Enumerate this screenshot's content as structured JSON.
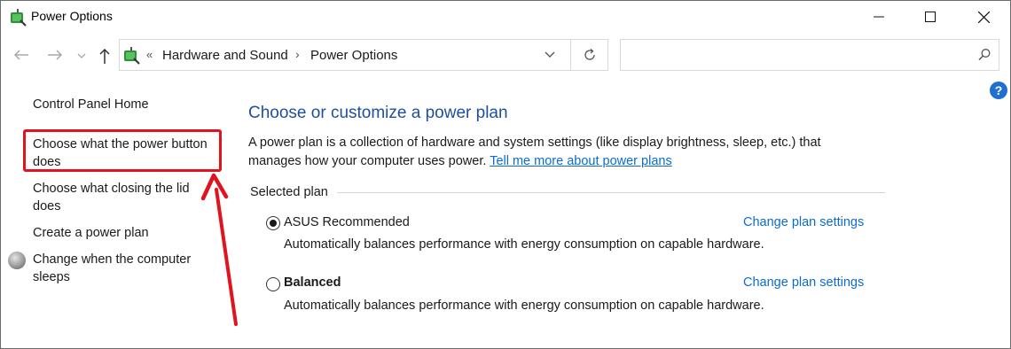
{
  "window": {
    "title": "Power Options"
  },
  "address": {
    "crumbs": [
      "Hardware and Sound",
      "Power Options"
    ],
    "search_placeholder": ""
  },
  "sidebar": {
    "items": [
      {
        "label": "Control Panel Home"
      },
      {
        "label": "Choose what the power button does"
      },
      {
        "label": "Choose what closing the lid does"
      },
      {
        "label": "Create a power plan"
      },
      {
        "label": "Change when the computer sleeps"
      }
    ]
  },
  "main": {
    "heading": "Choose or customize a power plan",
    "description": "A power plan is a collection of hardware and system settings (like display brightness, sleep, etc.) that manages how your computer uses power.",
    "learn_more_link": "Tell me more about power plans",
    "group_label": "Selected plan",
    "plans": [
      {
        "name": "ASUS Recommended",
        "selected": true,
        "description": "Automatically balances performance with energy consumption on capable hardware.",
        "link": "Change plan settings"
      },
      {
        "name": "Balanced",
        "selected": false,
        "description": "Automatically balances performance with energy consumption on capable hardware.",
        "link": "Change plan settings"
      }
    ]
  },
  "colors": {
    "accent_link": "#0b6cce",
    "heading": "#1f4e9e",
    "annotation_red": "#e0141e"
  },
  "icons": [
    "power-options-icon",
    "minimize-icon",
    "maximize-icon",
    "close-icon",
    "back-arrow-icon",
    "forward-arrow-icon",
    "recent-dropdown-icon",
    "up-arrow-icon",
    "refresh-icon",
    "search-icon",
    "help-icon",
    "sleep-moon-icon"
  ]
}
